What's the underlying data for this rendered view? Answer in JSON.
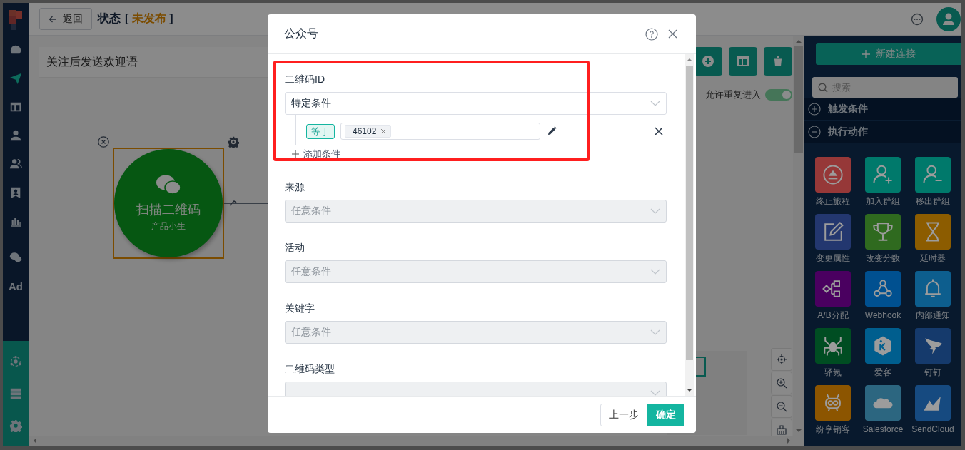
{
  "topbar": {
    "back_button": "返回",
    "title": "状态",
    "status": {
      "open": "[",
      "text": "未发布",
      "close": "]"
    }
  },
  "nav": {
    "items": [
      {
        "kind": "gauge",
        "selected": false
      },
      {
        "kind": "send",
        "selected": true
      },
      {
        "kind": "layout",
        "selected": false
      },
      {
        "kind": "user",
        "selected": false
      },
      {
        "kind": "users",
        "selected": false
      },
      {
        "kind": "badge",
        "selected": false
      },
      {
        "kind": "chart",
        "selected": false
      }
    ],
    "extra_items": [
      {
        "kind": "chat",
        "selected": false
      },
      {
        "kind": "text",
        "label": "Ad",
        "selected": false
      }
    ],
    "bottom_items": [
      {
        "kind": "network",
        "selected": false
      },
      {
        "kind": "server",
        "selected": false
      },
      {
        "kind": "settings",
        "selected": false
      }
    ]
  },
  "canvas": {
    "flow_name": "关注后发送欢迎语",
    "allow_reentry": {
      "label": "允许重复进入",
      "on": true
    },
    "node": {
      "title": "扫描二维码",
      "subtitle": "产品小生",
      "selected": true
    }
  },
  "right_panel": {
    "new_button": "新建连接",
    "search": {
      "placeholder": "搜索"
    },
    "sections": [
      {
        "title": "触发条件",
        "expanded": false
      },
      {
        "title": "执行动作",
        "expanded": true
      }
    ],
    "actions": [
      {
        "label": "终止旅程",
        "kind": "stop",
        "color": "#963838"
      },
      {
        "label": "加入群组",
        "kind": "user_add",
        "color": "#00796b"
      },
      {
        "label": "移出群组",
        "kind": "user_remove",
        "color": "#00796b"
      },
      {
        "label": "变更属性",
        "kind": "edit",
        "color": "#23376f"
      },
      {
        "label": "改变分数",
        "kind": "score",
        "color": "#2f6a1f"
      },
      {
        "label": "延时器",
        "kind": "delay",
        "color": "#8c5c00"
      },
      {
        "label": "A/B分配",
        "kind": "split",
        "color": "#4a0060"
      },
      {
        "label": "Webhook",
        "kind": "webhook",
        "color": "#005090"
      },
      {
        "label": "内部通知",
        "kind": "notify",
        "color": "#0d5e8e"
      },
      {
        "label": "驿氪",
        "kind": "spider",
        "color": "#004d22"
      },
      {
        "label": "爱客",
        "kind": "hexagon",
        "color": "#005e8e"
      },
      {
        "label": "钉钉",
        "kind": "wing",
        "color": "#153a6c"
      },
      {
        "label": "纷享销客",
        "kind": "robot",
        "color": "#8c5500"
      },
      {
        "label": "Salesforce",
        "kind": "cloud",
        "color": "#2c6680"
      },
      {
        "label": "SendCloud",
        "kind": "mountain",
        "color": "#164a80"
      }
    ]
  },
  "dialog": {
    "title": "公众号",
    "fields": [
      {
        "label": "二维码ID",
        "value": "特定条件",
        "disabled": false,
        "conditions": [
          {
            "operator": "等于",
            "tags": [
              "46102"
            ]
          }
        ],
        "add_condition": "添加条件"
      },
      {
        "label": "来源",
        "placeholder": "任意条件",
        "disabled": true
      },
      {
        "label": "活动",
        "placeholder": "任意条件",
        "disabled": true
      },
      {
        "label": "关键字",
        "placeholder": "任意条件",
        "disabled": true
      },
      {
        "label": "二维码类型",
        "disabled": true
      }
    ],
    "buttons": [
      {
        "label": "上一步",
        "kind": "secondary"
      },
      {
        "label": "确定",
        "kind": "primary"
      }
    ]
  }
}
